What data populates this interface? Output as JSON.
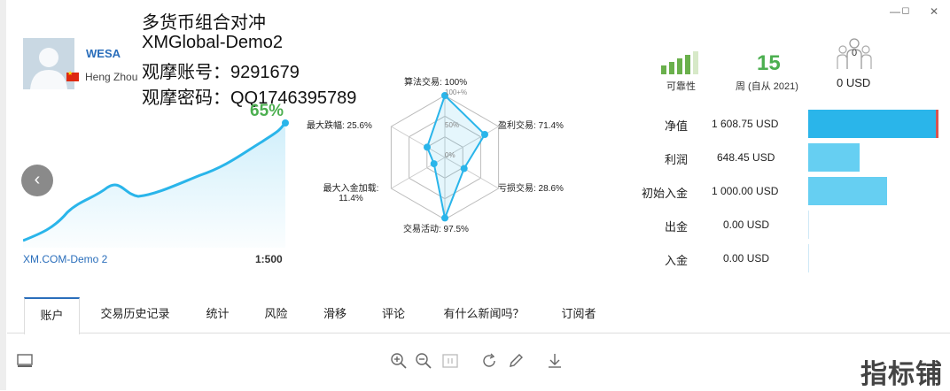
{
  "overlay": {
    "line1": "多货币组合对冲",
    "line2": "XMGlobal-Demo2",
    "line3": "观摩账号：9291679",
    "line4": "观摩密码：QQ1746395789"
  },
  "profile": {
    "name": "WESA",
    "author": "Heng Zhou",
    "broker": "XM.COM-Demo 2",
    "leverage": "1:500",
    "growth": "65%"
  },
  "radar": {
    "algo": "算法交易: 100%",
    "profit_trades": "盈利交易: 71.4%",
    "loss_trades": "亏损交易: 28.6%",
    "activity": "交易活动: 97.5%",
    "max_deposit_load_line1": "最大入金加载:",
    "max_deposit_load_line2": "11.4%",
    "max_drawdown": "最大跌幅: 25.6%",
    "scale_100": "100+%",
    "scale_50": "50%",
    "scale_0": "0%",
    "values": [
      1.0,
      0.714,
      0.286,
      0.975,
      0.114,
      0.256
    ]
  },
  "header_stats": {
    "reliability_label": "可靠性",
    "weeks_value": "15",
    "weeks_label": "周 (自从 2021)",
    "subscribers_count": "0",
    "subscribers_value": "0 USD"
  },
  "stats": [
    {
      "label": "净值",
      "value": "1 608.75 USD",
      "fraction": 1.0
    },
    {
      "label": "利润",
      "value": "648.45 USD",
      "fraction": 0.4
    },
    {
      "label": "初始入金",
      "value": "1 000.00 USD",
      "fraction": 0.62
    },
    {
      "label": "出金",
      "value": "0.00 USD",
      "fraction": 0
    },
    {
      "label": "入金",
      "value": "0.00 USD",
      "fraction": 0
    }
  ],
  "tabs": [
    "账户",
    "交易历史记录",
    "统计",
    "风险",
    "滑移",
    "评论",
    "有什么新闻吗？",
    "订阅者"
  ],
  "watermark": "指标铺",
  "colors": {
    "accent": "#2ab5ea",
    "bar_light": "#66cff2",
    "growth_green": "#4caf50",
    "reliability_green": "#6ab04c",
    "tab_active": "#2a6ebb"
  }
}
